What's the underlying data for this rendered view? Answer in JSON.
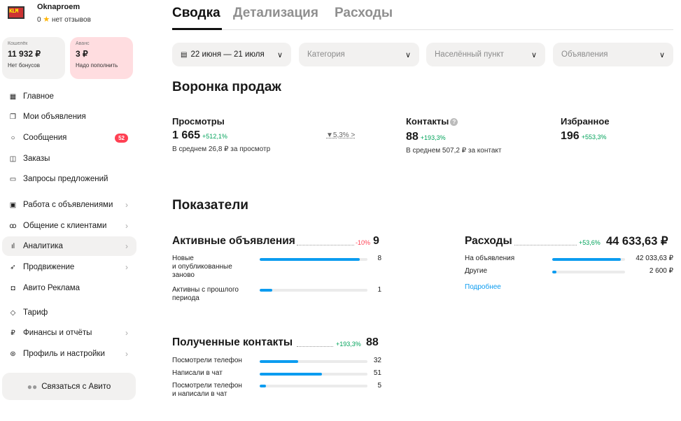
{
  "account": {
    "name": "Oknaproem",
    "rating": "0",
    "reviews": "нет отзывов",
    "logo_text": "KLM"
  },
  "wallets": [
    {
      "label": "Кошелёк",
      "value": "11 932 ₽",
      "note": "Нет бонусов"
    },
    {
      "label": "Аванс",
      "value": "3 ₽",
      "note": "Надо пополнить"
    }
  ],
  "nav": {
    "items": [
      {
        "label": "Главное",
        "icon": "grid-icon"
      },
      {
        "label": "Мои объявления",
        "icon": "copy-icon"
      },
      {
        "label": "Сообщения",
        "icon": "chat-icon",
        "badge": "52"
      },
      {
        "label": "Заказы",
        "icon": "box-icon"
      },
      {
        "label": "Запросы предложений",
        "icon": "folder-icon"
      },
      {
        "label": "Работа с объявлениями",
        "icon": "ad-icon"
      },
      {
        "label": "Общение с клиентами",
        "icon": "people-icon"
      },
      {
        "label": "Аналитика",
        "icon": "chart-icon"
      },
      {
        "label": "Продвижение",
        "icon": "rocket-icon"
      },
      {
        "label": "Авито Реклама",
        "icon": "megaphone-icon"
      },
      {
        "label": "Тариф",
        "icon": "diamond-icon"
      },
      {
        "label": "Финансы и отчёты",
        "icon": "ruble-icon"
      },
      {
        "label": "Профиль и настройки",
        "icon": "settings-icon"
      }
    ],
    "contact_button": "Связаться с Авито"
  },
  "tabs": [
    "Сводка",
    "Детализация",
    "Расходы"
  ],
  "filters": {
    "date": "22 июня — 21 июля",
    "category": "Категория",
    "city": "Населённый пункт",
    "ads": "Объявления"
  },
  "funnel": {
    "title": "Воронка продаж",
    "views": {
      "title": "Просмотры",
      "value": "1 665",
      "delta": "+512,1%",
      "sub": "В среднем 26,8 ₽ за просмотр"
    },
    "conversion": "▼5,3% >",
    "contacts": {
      "title": "Контакты",
      "value": "88",
      "delta": "+193,3%",
      "sub": "В среднем 507,2 ₽ за контакт"
    },
    "favorites": {
      "title": "Избранное",
      "value": "196",
      "delta": "+553,3%"
    }
  },
  "indicators": {
    "title": "Показатели",
    "active_ads": {
      "title": "Активные объявления",
      "delta": "-10%",
      "total": "9",
      "rows": [
        {
          "label": "Новые\nи опубликованные\nзаново",
          "value": "8",
          "fill": 0.93
        },
        {
          "label": "Активны с прошлого\nпериода",
          "value": "1",
          "fill": 0.12
        }
      ]
    },
    "contacts": {
      "title": "Полученные контакты",
      "delta": "+193,3%",
      "total": "88",
      "rows": [
        {
          "label": "Посмотрели телефон",
          "value": "32",
          "fill": 0.36
        },
        {
          "label": "Написали в чат",
          "value": "51",
          "fill": 0.58
        },
        {
          "label": "Посмотрели телефон\nи написали в чат",
          "value": "5",
          "fill": 0.06
        }
      ]
    },
    "expenses": {
      "title": "Расходы",
      "delta": "+53,6%",
      "total": "44 633,63 ₽",
      "rows": [
        {
          "label": "На объявления",
          "value": "42 033,63 ₽",
          "fill": 0.94
        },
        {
          "label": "Другие",
          "value": "2 600 ₽",
          "fill": 0.06
        }
      ],
      "link": "Подробнее"
    }
  },
  "colors": {
    "accent": "#0c9cf0",
    "positive": "#02a35b",
    "negative": "#ff4053",
    "badge": "#ff4053"
  }
}
